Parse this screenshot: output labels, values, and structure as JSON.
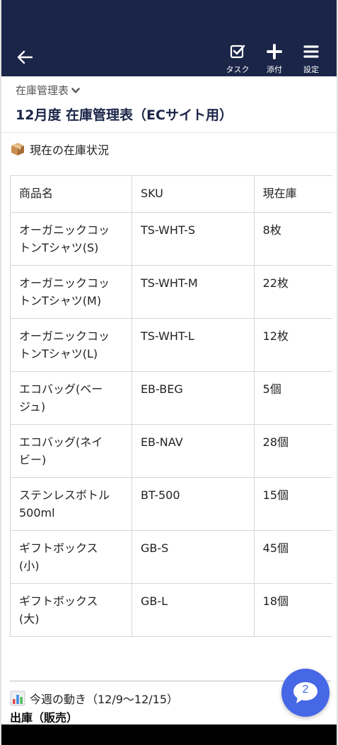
{
  "header": {
    "actions": [
      {
        "id": "task",
        "label": "タスク",
        "icon": "checkbox-icon"
      },
      {
        "id": "attach",
        "label": "添付",
        "icon": "plus-icon"
      },
      {
        "id": "settings",
        "label": "設定",
        "icon": "menu-icon"
      }
    ]
  },
  "breadcrumb": {
    "label": "在庫管理表"
  },
  "page": {
    "title": "12月度  在庫管理表（ECサイト用）"
  },
  "stock_section": {
    "icon": "package-icon",
    "heading": "現在の在庫状況",
    "columns": [
      "商品名",
      "SKU",
      "現在庫"
    ],
    "rows": [
      {
        "name_lines": [
          "オーガニックコッ",
          "トンTシャツ(S)"
        ],
        "sku": "TS-WHT-S",
        "stock": "8枚"
      },
      {
        "name_lines": [
          "オーガニックコッ",
          "トンTシャツ(M)"
        ],
        "sku": "TS-WHT-M",
        "stock": "22枚"
      },
      {
        "name_lines": [
          "オーガニックコッ",
          "トンTシャツ(L)"
        ],
        "sku": "TS-WHT-L",
        "stock": "12枚"
      },
      {
        "name_lines": [
          "エコバッグ(ベー",
          "ジュ)"
        ],
        "sku": "EB-BEG",
        "stock": "5個"
      },
      {
        "name_lines": [
          "エコバッグ(ネイ",
          "ビー)"
        ],
        "sku": "EB-NAV",
        "stock": "28個"
      },
      {
        "name_lines": [
          "ステンレスボトル",
          "500ml"
        ],
        "sku": "BT-500",
        "stock": "15個"
      },
      {
        "name_lines": [
          "ギフトボックス",
          "(小)"
        ],
        "sku": "GB-S",
        "stock": "45個"
      },
      {
        "name_lines": [
          "ギフトボックス",
          "(大)"
        ],
        "sku": "GB-L",
        "stock": "18個"
      }
    ]
  },
  "week_section": {
    "icon": "bar-chart-icon",
    "heading": "今週の動き（12/9〜12/15）",
    "subheading": "出庫（販売）"
  },
  "chat_fab": {
    "count": "2",
    "color": "#4667e6"
  },
  "colors": {
    "appbar": "#1b2548",
    "title": "#1b2548"
  }
}
